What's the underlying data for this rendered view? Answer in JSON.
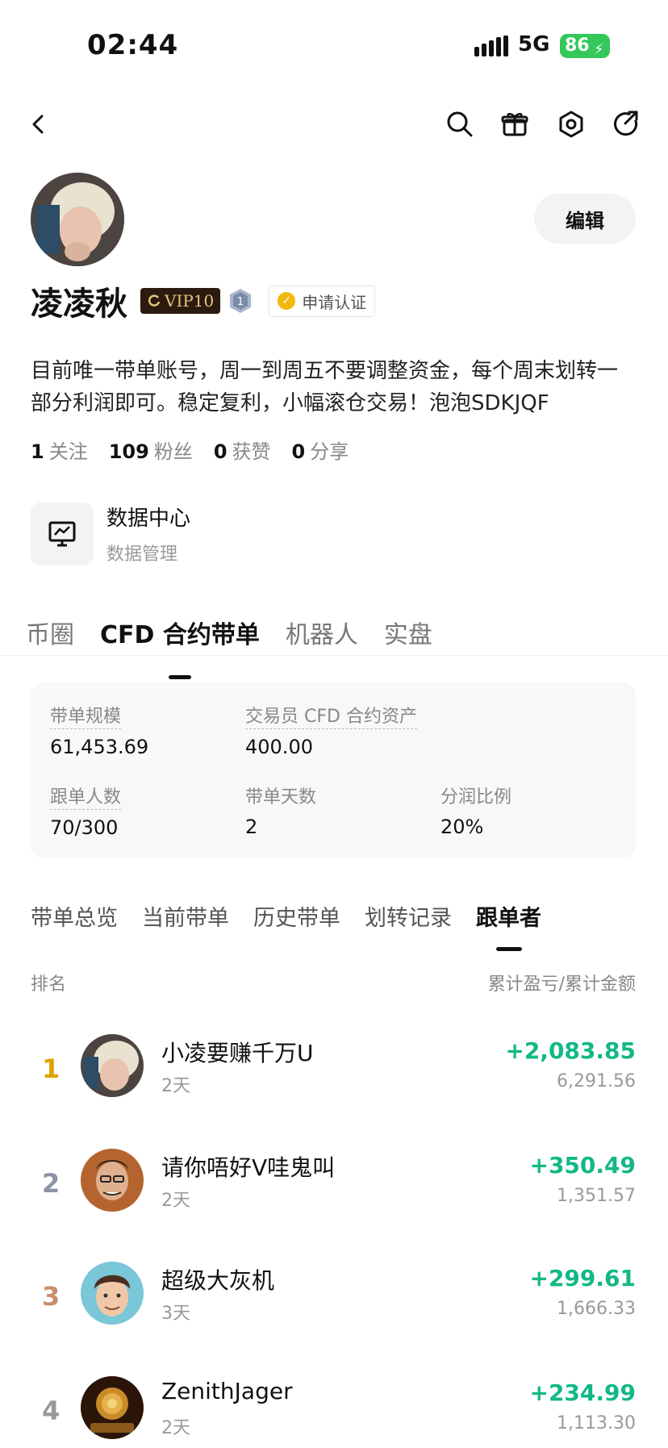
{
  "status": {
    "time": "02:44",
    "network": "5G",
    "battery": "86"
  },
  "profile": {
    "name": "凌凌秋",
    "vip": "VIP10",
    "level": "1",
    "verify": "申请认证",
    "edit": "编辑",
    "bio": "目前唯一带单账号，周一到周五不要调整资金，每个周末划转一部分利润即可。稳定复利，小幅滚仓交易！泡泡SDKJQF",
    "stats": [
      {
        "num": "1",
        "label": "关注"
      },
      {
        "num": "109",
        "label": "粉丝"
      },
      {
        "num": "0",
        "label": "获赞"
      },
      {
        "num": "0",
        "label": "分享"
      }
    ]
  },
  "data_center": {
    "title": "数据中心",
    "subtitle": "数据管理"
  },
  "main_tabs": [
    "币圈",
    "CFD 合约带单",
    "机器人",
    "实盘"
  ],
  "summary": {
    "scale_label": "带单规模",
    "scale_value": "61,453.69",
    "assets_label": "交易员 CFD 合约资产",
    "assets_value": "400.00",
    "followers_label": "跟单人数",
    "followers_value": "70/300",
    "days_label": "带单天数",
    "days_value": "2",
    "share_label": "分润比例",
    "share_value": "20%"
  },
  "sub_tabs": [
    "带单总览",
    "当前带单",
    "历史带单",
    "划转记录",
    "跟单者"
  ],
  "list_header": {
    "left": "排名",
    "right": "累计盈亏/累计金额"
  },
  "followers": [
    {
      "rank": "1",
      "name": "小凌要赚千万U",
      "days": "2天",
      "pnl": "+2,083.85",
      "amount": "6,291.56",
      "rank_color": "#e0a100"
    },
    {
      "rank": "2",
      "name": "请你唔好V哇鬼叫",
      "days": "2天",
      "pnl": "+350.49",
      "amount": "1,351.57",
      "rank_color": "#8a94a6"
    },
    {
      "rank": "3",
      "name": "超级大灰机",
      "days": "3天",
      "pnl": "+299.61",
      "amount": "1,666.33",
      "rank_color": "#c98d6b"
    },
    {
      "rank": "4",
      "name": "ZenithJager",
      "days": "2天",
      "pnl": "+234.99",
      "amount": "1,113.30",
      "rank_color": "#999999"
    }
  ],
  "colors": {
    "profit": "#12b886",
    "vip_bg": "#2a1a10",
    "vip_text": "#e8c27a",
    "battery": "#34c759"
  }
}
